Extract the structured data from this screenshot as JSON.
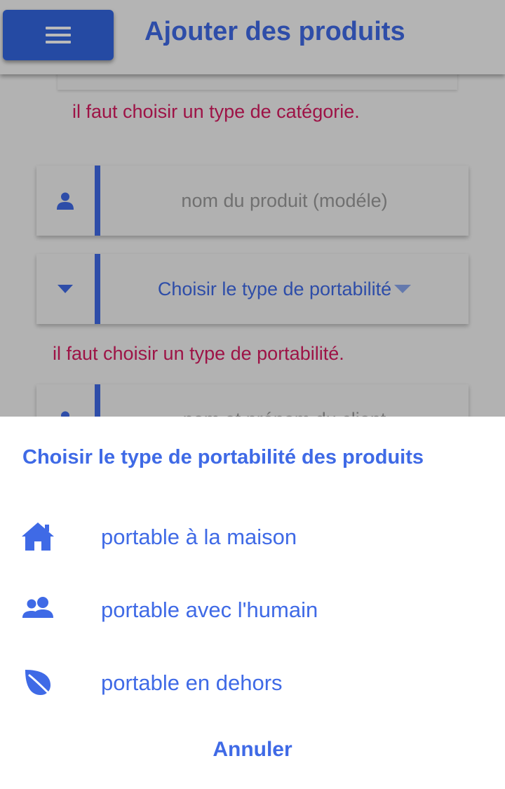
{
  "header": {
    "title": "Ajouter des produits",
    "menu_icon": "hamburger-menu-icon"
  },
  "form": {
    "category_error": "il faut choisir un type de catégorie.",
    "product_name": {
      "icon": "user-icon",
      "placeholder": "nom du produit (modéle)"
    },
    "portability": {
      "icon": "caret-down-icon",
      "value": "Choisir le type de portabilité"
    },
    "portability_error": "il faut choisir un type de portabilité.",
    "client_name": {
      "icon": "user-icon",
      "placeholder": "nom et prénom du client"
    }
  },
  "sheet": {
    "title": "Choisir le type de portabilité des produits",
    "options": [
      {
        "icon": "home-icon",
        "label": "portable à la maison"
      },
      {
        "icon": "users-icon",
        "label": "portable avec l'humain"
      },
      {
        "icon": "leaf-icon",
        "label": "portable en dehors"
      }
    ],
    "cancel_label": "Annuler"
  },
  "colors": {
    "accent": "#3f6ae6",
    "menu_button": "#3366e0",
    "error": "#d81b60",
    "placeholder": "#9a9a9a"
  }
}
